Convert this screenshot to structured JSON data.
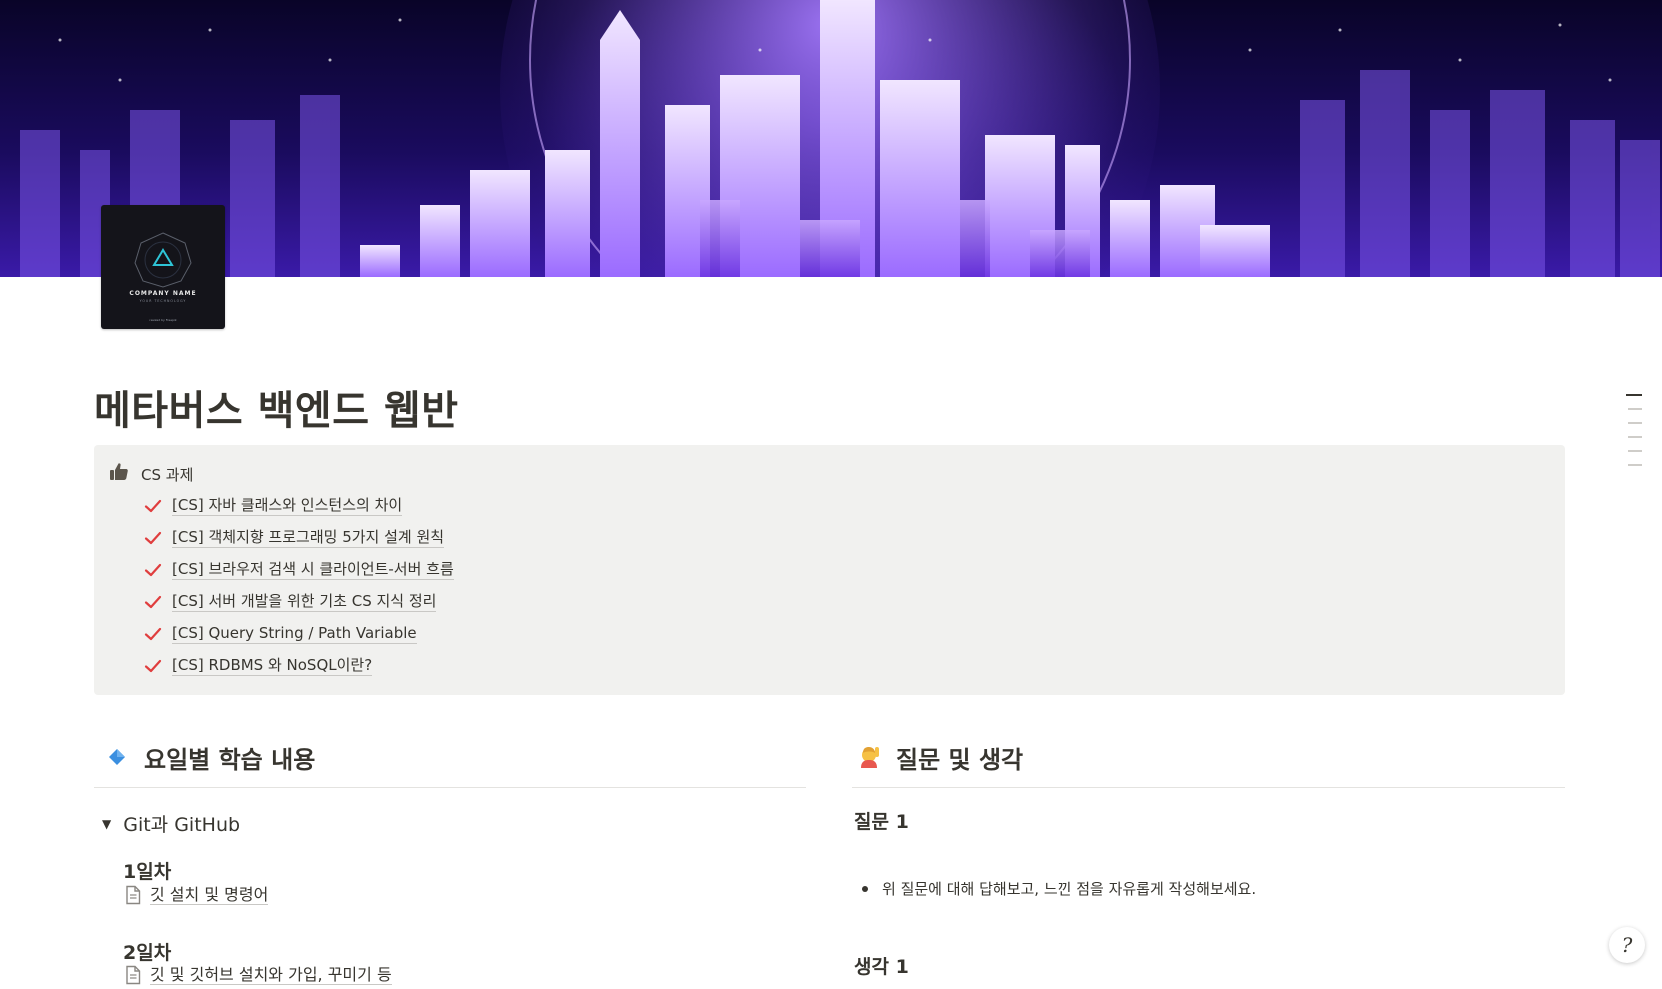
{
  "title": "메타버스 백엔드 웹반",
  "page_icon": {
    "name": "company-logo",
    "label": "COMPANY NAME",
    "tagline": "YOUR TECHNOLOGY",
    "credit": "resized by Freepik"
  },
  "callout": {
    "icon": "thumbs-up-icon",
    "title": "CS 과제",
    "items": [
      "[CS] 자바 클래스와 인스턴스의 차이",
      "[CS] 객체지향 프로그래밍 5가지 설계 원칙",
      "[CS] 브라우저 검색 시 클라이언트-서버 흐름",
      "[CS] 서버 개발을 위한 기초 CS 지식 정리",
      "[CS] Query String / Path Variable",
      "[CS] RDBMS 와 NoSQL이란?"
    ],
    "check_color": "#e03e3e"
  },
  "left": {
    "heading": "요일별 학습 내용",
    "heading_icon": "blue-diamond-icon",
    "toggle": "Git과 GitHub",
    "days": [
      {
        "label": "1일차",
        "page": "깃 설치 및 명령어"
      },
      {
        "label": "2일차",
        "page": "깃 및 깃허브 설치와 가입, 꾸미기 등"
      }
    ]
  },
  "right": {
    "heading": "질문 및 생각",
    "heading_icon": "person-raising-hand-icon",
    "q1": "질문 1",
    "bullet": "위 질문에 대해 답해보고, 느낀 점을 자유롭게 작성해보세요.",
    "t1": "생각 1"
  },
  "help_label": "?",
  "colors": {
    "text": "#37352f",
    "callout_bg": "#f1f1ef",
    "accent_blue": "#2e8fe6"
  }
}
